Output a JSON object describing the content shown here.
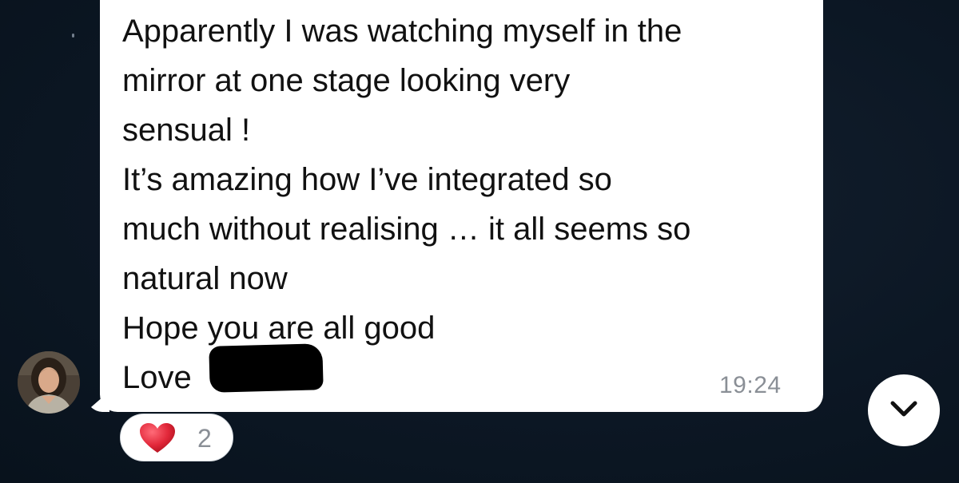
{
  "message": {
    "lines": [
      "Apparently I was watching myself in the",
      "mirror at one stage looking very",
      "sensual !",
      "It’s amazing how I’ve integrated so",
      "much without realising … it all seems so",
      "natural now",
      "Hope you are all good",
      "Love"
    ],
    "time": "19:24"
  },
  "reaction": {
    "icon": "heart-icon",
    "count": "2"
  },
  "scroll_button": {
    "icon": "chevron-down-icon"
  },
  "colors": {
    "background": "#0c1724",
    "bubble": "#ffffff",
    "timestamp": "#8a8f96",
    "heart": "#e2283a"
  }
}
